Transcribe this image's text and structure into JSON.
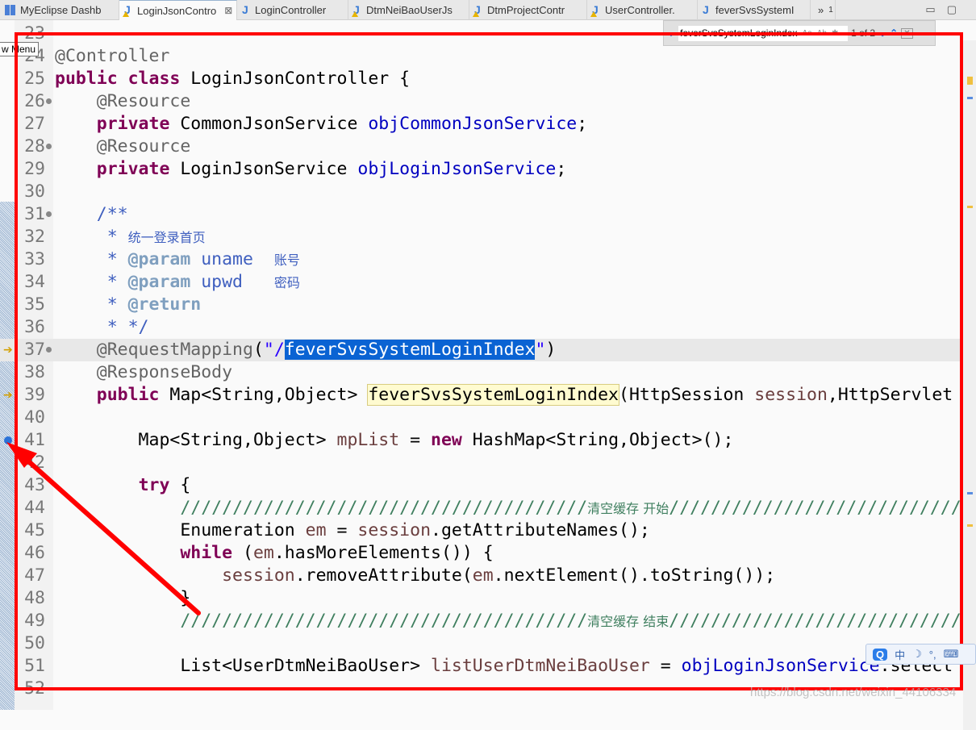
{
  "tabs": [
    {
      "label": "MyEclipse Dashb",
      "icon": "dashboard-icon",
      "active": false
    },
    {
      "label": "LoginJsonContro",
      "icon": "java-warning-icon",
      "active": true,
      "close": "⊠"
    },
    {
      "label": "LoginController",
      "icon": "java-file-icon",
      "active": false
    },
    {
      "label": "DtmNeiBaoUserJs",
      "icon": "java-warning-icon",
      "active": false
    },
    {
      "label": "DtmProjectContr",
      "icon": "java-warning-icon",
      "active": false
    },
    {
      "label": "UserController.",
      "icon": "java-warning-icon",
      "active": false
    },
    {
      "label": "feverSvsSystemI",
      "icon": "web-file-icon",
      "active": false
    }
  ],
  "overflow": {
    "label": "»",
    "count": "1"
  },
  "window_buttons": {
    "minimize": "▭",
    "maximize": "▢"
  },
  "tooltip": "w Menu",
  "find": {
    "value": "feverSvsSystemLoginIndex",
    "case": "Aa",
    "word": "Ab",
    "regex": "✱",
    "count": "1 of 2",
    "next": "⌄",
    "prev": "⌃",
    "close": "✕",
    "expand": "⌄"
  },
  "code": [
    {
      "n": "23",
      "t": []
    },
    {
      "n": "24",
      "t": [
        [
          "an",
          "@Controller"
        ]
      ]
    },
    {
      "n": "25",
      "t": [
        [
          "kw",
          "public class "
        ],
        [
          "",
          "LoginJsonController {"
        ]
      ]
    },
    {
      "n": "26",
      "fold": true,
      "t": [
        [
          "",
          "    "
        ],
        [
          "an",
          "@Resource"
        ]
      ]
    },
    {
      "n": "27",
      "t": [
        [
          "",
          "    "
        ],
        [
          "kw",
          "private "
        ],
        [
          "",
          "CommonJsonService "
        ],
        [
          "fld",
          "objCommonJsonService"
        ],
        [
          "",
          ";"
        ]
      ]
    },
    {
      "n": "28",
      "fold": true,
      "t": [
        [
          "",
          "    "
        ],
        [
          "an",
          "@Resource"
        ]
      ]
    },
    {
      "n": "29",
      "t": [
        [
          "",
          "    "
        ],
        [
          "kw",
          "private "
        ],
        [
          "",
          "LoginJsonService "
        ],
        [
          "fld",
          "objLoginJsonService"
        ],
        [
          "",
          ";"
        ]
      ]
    },
    {
      "n": "30",
      "t": []
    },
    {
      "n": "31",
      "fold": true,
      "t": [
        [
          "",
          "    "
        ],
        [
          "jd",
          "/**"
        ]
      ]
    },
    {
      "n": "32",
      "t": [
        [
          "jd",
          "     * "
        ],
        [
          "jd zh",
          "统一登录首页"
        ]
      ]
    },
    {
      "n": "33",
      "t": [
        [
          "jd",
          "     * "
        ],
        [
          "jt",
          "@param "
        ],
        [
          "jd",
          "uname  "
        ],
        [
          "jd zh",
          "账号"
        ]
      ]
    },
    {
      "n": "34",
      "t": [
        [
          "jd",
          "     * "
        ],
        [
          "jt",
          "@param "
        ],
        [
          "jd",
          "upwd   "
        ],
        [
          "jd zh",
          "密码"
        ]
      ]
    },
    {
      "n": "35",
      "t": [
        [
          "jd",
          "     * "
        ],
        [
          "jt",
          "@return"
        ]
      ]
    },
    {
      "n": "36",
      "t": [
        [
          "jd",
          "     * */"
        ]
      ]
    },
    {
      "n": "37",
      "fold": true,
      "cur": true,
      "t": [
        [
          "",
          "    "
        ],
        [
          "an",
          "@RequestMapping"
        ],
        [
          "",
          "("
        ],
        [
          "str",
          "\"/"
        ],
        [
          "str sel",
          "feverSvsSystemLoginIndex"
        ],
        [
          "str",
          "\""
        ],
        [
          "",
          ")"
        ]
      ]
    },
    {
      "n": "38",
      "t": [
        [
          "",
          "    "
        ],
        [
          "an",
          "@ResponseBody"
        ]
      ]
    },
    {
      "n": "39",
      "t": [
        [
          "",
          "    "
        ],
        [
          "kw",
          "public "
        ],
        [
          "",
          "Map<String,Object> "
        ],
        [
          "occ",
          "feverSvsSystemLoginIndex"
        ],
        [
          "",
          "(HttpSession "
        ],
        [
          "var",
          "session"
        ],
        [
          "",
          ",HttpServlet"
        ]
      ]
    },
    {
      "n": "40",
      "t": []
    },
    {
      "n": "41",
      "t": [
        [
          "",
          "        Map<String,Object> "
        ],
        [
          "var",
          "mpList"
        ],
        [
          "",
          " = "
        ],
        [
          "kw",
          "new "
        ],
        [
          "",
          "HashMap<String,Object>();"
        ]
      ]
    },
    {
      "n": "42",
      "t": []
    },
    {
      "n": "43",
      "t": [
        [
          "",
          "        "
        ],
        [
          "kw",
          "try"
        ],
        [
          "",
          " {"
        ]
      ]
    },
    {
      "n": "44",
      "t": [
        [
          "",
          "            "
        ],
        [
          "cm",
          "///////////////////////////////////////"
        ],
        [
          "cm zh",
          "清空缓存 开始"
        ],
        [
          "cm",
          "//////////////////////////////"
        ]
      ]
    },
    {
      "n": "45",
      "t": [
        [
          "",
          "            Enumeration "
        ],
        [
          "var",
          "em"
        ],
        [
          "",
          " = "
        ],
        [
          "var",
          "session"
        ],
        [
          "",
          ".getAttributeNames();"
        ]
      ]
    },
    {
      "n": "46",
      "t": [
        [
          "",
          "            "
        ],
        [
          "kw",
          "while"
        ],
        [
          "",
          " ("
        ],
        [
          "var",
          "em"
        ],
        [
          "",
          ".hasMoreElements()) {"
        ]
      ]
    },
    {
      "n": "47",
      "t": [
        [
          "",
          "                "
        ],
        [
          "var",
          "session"
        ],
        [
          "",
          ".removeAttribute("
        ],
        [
          "var",
          "em"
        ],
        [
          "",
          ".nextElement().toString());"
        ]
      ]
    },
    {
      "n": "48",
      "t": [
        [
          "",
          "            }"
        ]
      ]
    },
    {
      "n": "49",
      "t": [
        [
          "",
          "            "
        ],
        [
          "cm",
          "///////////////////////////////////////"
        ],
        [
          "cm zh",
          "清空缓存 结束"
        ],
        [
          "cm",
          "//////////////////////////////"
        ]
      ]
    },
    {
      "n": "50",
      "t": []
    },
    {
      "n": "51",
      "t": [
        [
          "",
          "            List<UserDtmNeiBaoUser> "
        ],
        [
          "var",
          "listUserDtmNeiBaoUser"
        ],
        [
          "",
          " = "
        ],
        [
          "fld",
          "objLoginJsonService"
        ],
        [
          "",
          ".select"
        ]
      ]
    },
    {
      "n": "52",
      "t": []
    }
  ],
  "ime": {
    "icon": "Q",
    "lang": "中",
    "moon": "☽",
    "punct": "°,",
    "keyboard": "⌨"
  },
  "watermark": "https://blog.csdn.net/weixin_44106334",
  "colors": {
    "annotation_box": "#ff0000",
    "selection": "#0a63d3",
    "keyword": "#7f0055"
  }
}
